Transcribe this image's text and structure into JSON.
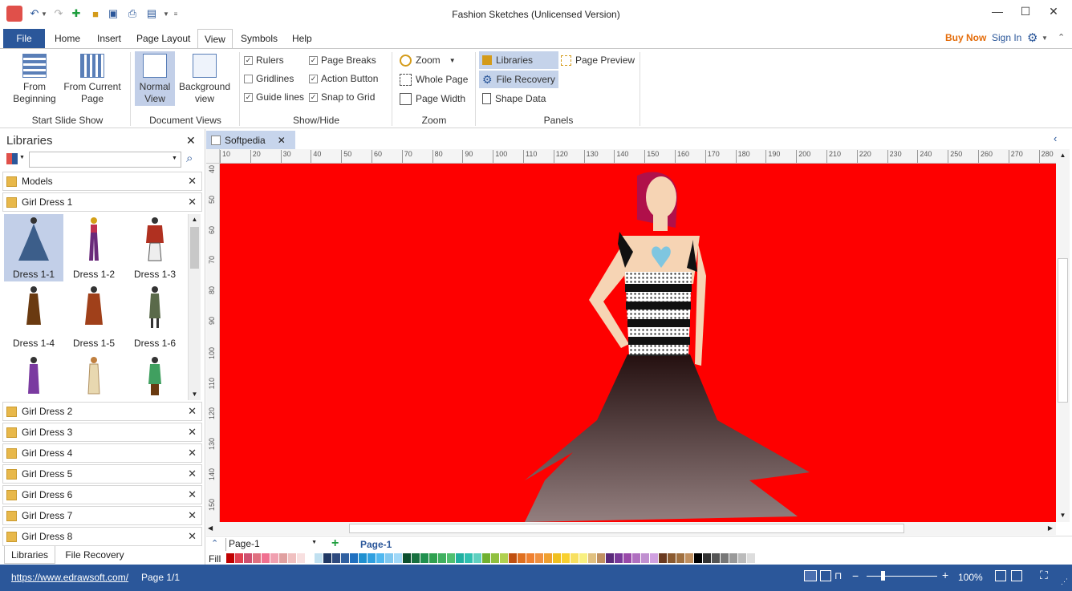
{
  "window": {
    "title": "Fashion Sketches (Unlicensed Version)"
  },
  "menu": {
    "file": "File",
    "home": "Home",
    "insert": "Insert",
    "page_layout": "Page Layout",
    "view": "View",
    "symbols": "Symbols",
    "help": "Help",
    "buy_now": "Buy Now",
    "sign_in": "Sign In"
  },
  "ribbon": {
    "slide_show": {
      "from_beginning_1": "From",
      "from_beginning_2": "Beginning",
      "from_current_1": "From Current",
      "from_current_2": "Page",
      "label": "Start Slide Show"
    },
    "doc_views": {
      "normal_1": "Normal",
      "normal_2": "View",
      "background_1": "Background",
      "background_2": "view",
      "label": "Document Views"
    },
    "show_hide": {
      "rulers": "Rulers",
      "gridlines": "Gridlines",
      "guide_lines": "Guide lines",
      "page_breaks": "Page Breaks",
      "action_button": "Action Button",
      "snap_to_grid": "Snap to Grid",
      "label": "Show/Hide"
    },
    "zoom": {
      "zoom": "Zoom",
      "whole_page": "Whole Page",
      "page_width": "Page Width",
      "label": "Zoom"
    },
    "panels": {
      "libraries": "Libraries",
      "file_recovery": "File Recovery",
      "shape_data": "Shape Data",
      "page_preview": "Page Preview",
      "label": "Panels"
    }
  },
  "libraries": {
    "title": "Libraries",
    "models": "Models",
    "open_group": "Girl Dress 1",
    "thumbs": [
      "Dress 1-1",
      "Dress 1-2",
      "Dress 1-3",
      "Dress 1-4",
      "Dress 1-5",
      "Dress 1-6"
    ],
    "groups": [
      "Girl Dress 2",
      "Girl Dress 3",
      "Girl Dress 4",
      "Girl Dress 5",
      "Girl Dress 6",
      "Girl Dress 7",
      "Girl Dress 8"
    ],
    "tab_libraries": "Libraries",
    "tab_recovery": "File Recovery"
  },
  "document": {
    "tab": "Softpedia",
    "hruler": [
      "10",
      "20",
      "30",
      "40",
      "50",
      "60",
      "70",
      "80",
      "90",
      "100",
      "110",
      "120",
      "130",
      "140",
      "150",
      "160",
      "170",
      "180",
      "190",
      "200",
      "210",
      "220",
      "230",
      "240",
      "250",
      "260",
      "270",
      "280"
    ],
    "vruler": [
      "40",
      "50",
      "60",
      "70",
      "80",
      "90",
      "100",
      "110",
      "120",
      "130",
      "140",
      "150"
    ],
    "page_select": "Page-1",
    "page_tab": "Page-1",
    "fill_label": "Fill"
  },
  "status": {
    "url": "https://www.edrawsoft.com/",
    "page": "Page 1/1",
    "zoom": "100%"
  },
  "colors": {
    "accent": "#2b579a",
    "canvas": "#fe0000",
    "buy": "#e46c0a"
  }
}
